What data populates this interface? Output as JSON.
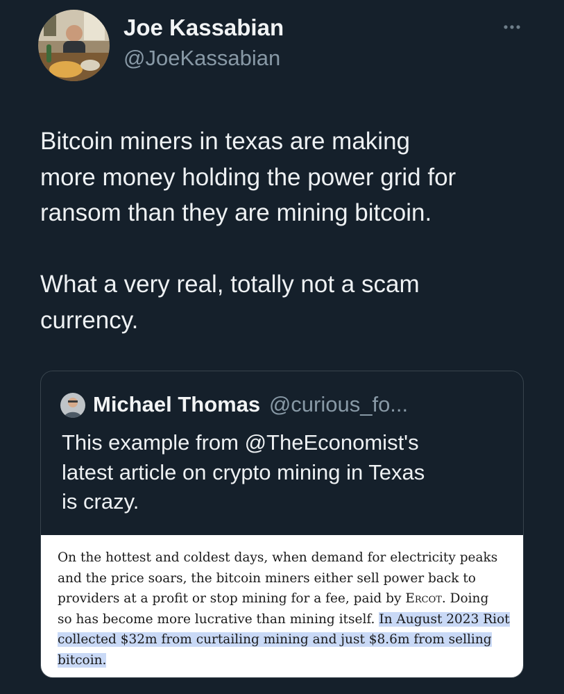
{
  "tweet": {
    "author": {
      "display_name": "Joe Kassabian",
      "handle": "@JoeKassabian",
      "avatar_icon": "profile-photo-icon"
    },
    "more_icon": "more-horizontal-icon",
    "text_paragraphs": [
      [
        "Bitcoin miners in texas are making",
        "more money holding the power grid for",
        "ransom than they are mining bitcoin."
      ],
      [
        "What a very real, totally not a scam",
        "currency."
      ]
    ]
  },
  "quoted_tweet": {
    "author": {
      "display_name": "Michael Thomas",
      "handle": "@curious_fo...",
      "avatar_icon": "profile-photo-icon"
    },
    "text_lines": [
      "This example from @TheEconomist's",
      "latest article on crypto mining in Texas",
      "is crazy."
    ],
    "article_excerpt": {
      "lines": [
        "On the hottest and coldest days, when demand for electricity peaks",
        "and the price soars, the bitcoin miners either sell power back to",
        "providers at a profit or stop mining for a fee, paid by ERCOT. Doing",
        "so has become more lucrative than mining itself. In August 2023 Riot",
        "collected $32m from curtailing mining and just $8.6m from selling",
        "bitcoin."
      ],
      "line3_before": "providers at a profit or stop mining for a fee, paid by ",
      "line3_smallcaps": "Ercot",
      "line3_after": ". Doing",
      "line4_plain": "so has become more lucrative than mining itself. ",
      "line4_highlight": "In August 2023 Riot",
      "line5_highlight": "collected $32m from curtailing mining and just $8.6m from selling",
      "line6_highlight": "bitcoin.",
      "highlight_color": "#c9d9f6"
    }
  },
  "colors": {
    "background": "#15202b",
    "text_primary": "#f2f4f5",
    "text_secondary": "#8899a6",
    "card_border": "#38444d"
  }
}
